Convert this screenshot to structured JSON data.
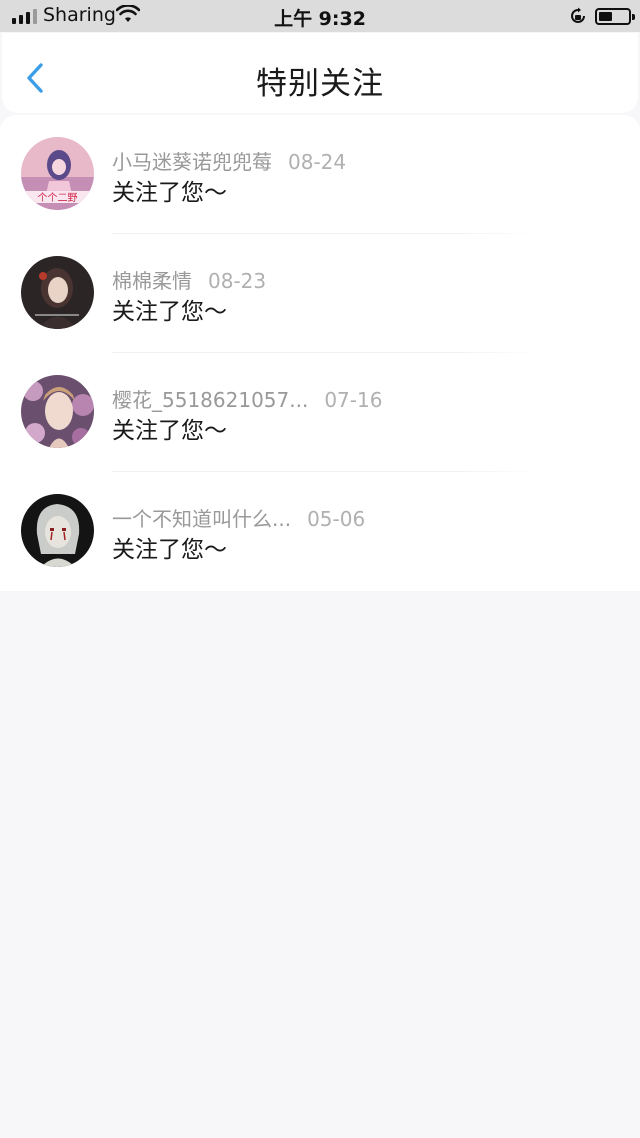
{
  "status_bar": {
    "carrier": "Sharing",
    "time": "上午 9:32"
  },
  "header": {
    "title": "特别关注"
  },
  "notifications": [
    {
      "name": "小马迷葵诺兜兜莓",
      "date": "08-24",
      "message": "关注了您～",
      "avatar": "avatar-pink-cartoon"
    },
    {
      "name": "棉棉柔情",
      "date": "08-23",
      "message": "关注了您～",
      "avatar": "avatar-dark-girl"
    },
    {
      "name": "樱花_5518621057...",
      "date": "07-16",
      "message": "关注了您～",
      "avatar": "avatar-flower-portrait"
    },
    {
      "name": "一个不知道叫什么...",
      "date": "05-06",
      "message": "关注了您～",
      "avatar": "avatar-white-hair"
    }
  ],
  "colors": {
    "accent": "#3d9ee8",
    "status_bar_bg": "#dcdcdc",
    "page_bg": "#f7f6f9"
  }
}
